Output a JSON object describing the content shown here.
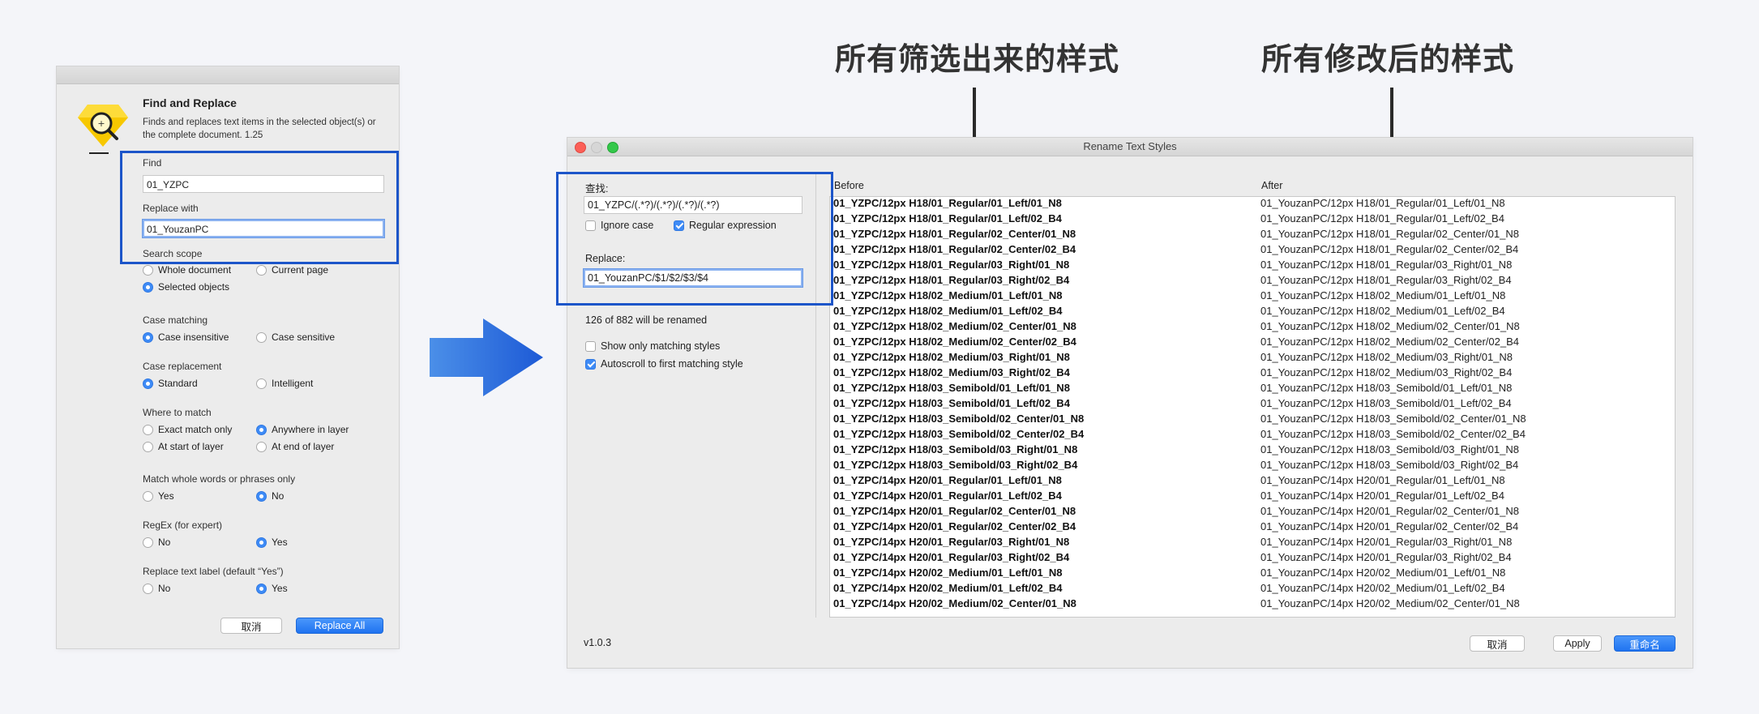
{
  "annotations": {
    "left": "所有筛选出来的样式",
    "right": "所有修改后的样式"
  },
  "find_replace": {
    "title": "Find and Replace",
    "description": "Finds and replaces text items in the selected object(s) or the complete document. 1.25",
    "find_label": "Find",
    "find_value": "01_YZPC",
    "replace_label": "Replace with",
    "replace_value": "01_YouzanPC",
    "scope_label": "Search scope",
    "scope_whole": "Whole document",
    "scope_page": "Current page",
    "scope_selected": "Selected objects",
    "case_label": "Case matching",
    "case_insensitive": "Case insensitive",
    "case_sensitive": "Case sensitive",
    "replace_case_label": "Case replacement",
    "replace_case_standard": "Standard",
    "replace_case_intelligent": "Intelligent",
    "where_label": "Where to match",
    "where_exact": "Exact match only",
    "where_anywhere": "Anywhere in layer",
    "where_start": "At start of layer",
    "where_end": "At end of layer",
    "whole_label": "Match whole words or phrases only",
    "whole_yes": "Yes",
    "whole_no": "No",
    "regex_label": "RegEx (for expert)",
    "regex_no": "No",
    "regex_yes": "Yes",
    "label_label": "Replace text label (default “Yes”)",
    "label_no": "No",
    "label_yes": "Yes",
    "cancel_label": "取消",
    "replace_all_label": "Replace All"
  },
  "rename": {
    "window_title": "Rename Text Styles",
    "find_label": "查找:",
    "find_value": "01_YZPC/(.*?)/(.*?)/(.*?)/(.*?)",
    "ignore_case": "Ignore case",
    "regex": "Regular expression",
    "replace_label": "Replace:",
    "replace_value": "01_YouzanPC/$1/$2/$3/$4",
    "count_text": "126 of 882 will be renamed",
    "show_matching": "Show only matching styles",
    "autoscroll": "Autoscroll to first matching style",
    "version": "v1.0.3",
    "before_header": "Before",
    "after_header": "After",
    "cancel_label": "取消",
    "apply_label": "Apply",
    "rename_label": "重命名",
    "rows": [
      {
        "before": "01_YZPC/12px H18/01_Regular/01_Left/01_N8",
        "after": "01_YouzanPC/12px H18/01_Regular/01_Left/01_N8"
      },
      {
        "before": "01_YZPC/12px H18/01_Regular/01_Left/02_B4",
        "after": "01_YouzanPC/12px H18/01_Regular/01_Left/02_B4"
      },
      {
        "before": "01_YZPC/12px H18/01_Regular/02_Center/01_N8",
        "after": "01_YouzanPC/12px H18/01_Regular/02_Center/01_N8"
      },
      {
        "before": "01_YZPC/12px H18/01_Regular/02_Center/02_B4",
        "after": "01_YouzanPC/12px H18/01_Regular/02_Center/02_B4"
      },
      {
        "before": "01_YZPC/12px H18/01_Regular/03_Right/01_N8",
        "after": "01_YouzanPC/12px H18/01_Regular/03_Right/01_N8"
      },
      {
        "before": "01_YZPC/12px H18/01_Regular/03_Right/02_B4",
        "after": "01_YouzanPC/12px H18/01_Regular/03_Right/02_B4"
      },
      {
        "before": "01_YZPC/12px H18/02_Medium/01_Left/01_N8",
        "after": "01_YouzanPC/12px H18/02_Medium/01_Left/01_N8"
      },
      {
        "before": "01_YZPC/12px H18/02_Medium/01_Left/02_B4",
        "after": "01_YouzanPC/12px H18/02_Medium/01_Left/02_B4"
      },
      {
        "before": "01_YZPC/12px H18/02_Medium/02_Center/01_N8",
        "after": "01_YouzanPC/12px H18/02_Medium/02_Center/01_N8"
      },
      {
        "before": "01_YZPC/12px H18/02_Medium/02_Center/02_B4",
        "after": "01_YouzanPC/12px H18/02_Medium/02_Center/02_B4"
      },
      {
        "before": "01_YZPC/12px H18/02_Medium/03_Right/01_N8",
        "after": "01_YouzanPC/12px H18/02_Medium/03_Right/01_N8"
      },
      {
        "before": "01_YZPC/12px H18/02_Medium/03_Right/02_B4",
        "after": "01_YouzanPC/12px H18/02_Medium/03_Right/02_B4"
      },
      {
        "before": "01_YZPC/12px H18/03_Semibold/01_Left/01_N8",
        "after": "01_YouzanPC/12px H18/03_Semibold/01_Left/01_N8"
      },
      {
        "before": "01_YZPC/12px H18/03_Semibold/01_Left/02_B4",
        "after": "01_YouzanPC/12px H18/03_Semibold/01_Left/02_B4"
      },
      {
        "before": "01_YZPC/12px H18/03_Semibold/02_Center/01_N8",
        "after": "01_YouzanPC/12px H18/03_Semibold/02_Center/01_N8"
      },
      {
        "before": "01_YZPC/12px H18/03_Semibold/02_Center/02_B4",
        "after": "01_YouzanPC/12px H18/03_Semibold/02_Center/02_B4"
      },
      {
        "before": "01_YZPC/12px H18/03_Semibold/03_Right/01_N8",
        "after": "01_YouzanPC/12px H18/03_Semibold/03_Right/01_N8"
      },
      {
        "before": "01_YZPC/12px H18/03_Semibold/03_Right/02_B4",
        "after": "01_YouzanPC/12px H18/03_Semibold/03_Right/02_B4"
      },
      {
        "before": "01_YZPC/14px H20/01_Regular/01_Left/01_N8",
        "after": "01_YouzanPC/14px H20/01_Regular/01_Left/01_N8"
      },
      {
        "before": "01_YZPC/14px H20/01_Regular/01_Left/02_B4",
        "after": "01_YouzanPC/14px H20/01_Regular/01_Left/02_B4"
      },
      {
        "before": "01_YZPC/14px H20/01_Regular/02_Center/01_N8",
        "after": "01_YouzanPC/14px H20/01_Regular/02_Center/01_N8"
      },
      {
        "before": "01_YZPC/14px H20/01_Regular/02_Center/02_B4",
        "after": "01_YouzanPC/14px H20/01_Regular/02_Center/02_B4"
      },
      {
        "before": "01_YZPC/14px H20/01_Regular/03_Right/01_N8",
        "after": "01_YouzanPC/14px H20/01_Regular/03_Right/01_N8"
      },
      {
        "before": "01_YZPC/14px H20/01_Regular/03_Right/02_B4",
        "after": "01_YouzanPC/14px H20/01_Regular/03_Right/02_B4"
      },
      {
        "before": "01_YZPC/14px H20/02_Medium/01_Left/01_N8",
        "after": "01_YouzanPC/14px H20/02_Medium/01_Left/01_N8"
      },
      {
        "before": "01_YZPC/14px H20/02_Medium/01_Left/02_B4",
        "after": "01_YouzanPC/14px H20/02_Medium/01_Left/02_B4"
      },
      {
        "before": "01_YZPC/14px H20/02_Medium/02_Center/01_N8",
        "after": "01_YouzanPC/14px H20/02_Medium/02_Center/01_N8"
      }
    ]
  }
}
